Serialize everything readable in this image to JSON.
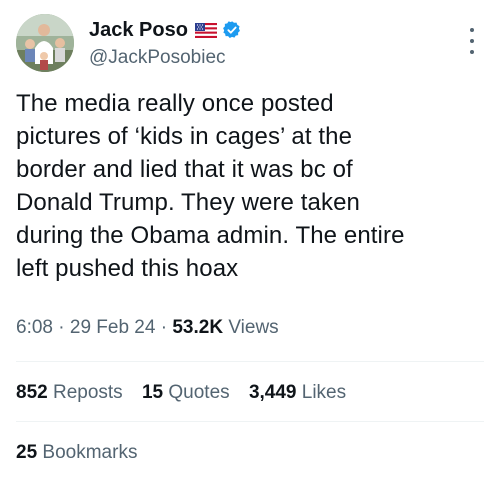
{
  "author": {
    "display_name": "Jack Poso",
    "handle": "@JackPosobiec",
    "flag_icon": "us-flag-icon",
    "verified_icon": "verified-badge-icon",
    "verified_color": "#1d9bf0"
  },
  "tweet": {
    "text": "The media really once posted\npictures of ‘kids in cages’ at the\nborder and lied that it was bc of\nDonald Trump. They were taken\nduring the Obama admin. The entire\nleft pushed this hoax"
  },
  "meta": {
    "time": "6:08",
    "separator": "·",
    "date": "29 Feb 24",
    "views_count": "53.2K",
    "views_label": "Views"
  },
  "stats": {
    "reposts_count": "852",
    "reposts_label": "Reposts",
    "quotes_count": "15",
    "quotes_label": "Quotes",
    "likes_count": "3,449",
    "likes_label": "Likes"
  },
  "bookmarks": {
    "count": "25",
    "label": "Bookmarks"
  },
  "menu": {
    "icon": "more-vertical-icon"
  },
  "colors": {
    "text_primary": "#0f1419",
    "text_secondary": "#536471",
    "divider": "#eff3f4"
  }
}
